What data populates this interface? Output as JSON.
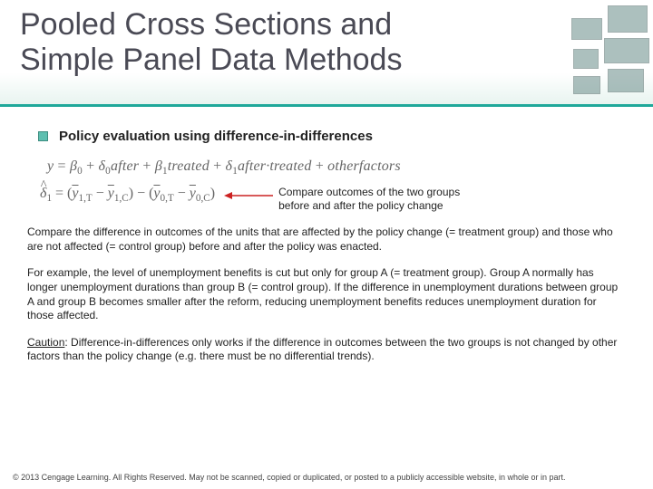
{
  "header": {
    "title_line1": "Pooled Cross Sections and",
    "title_line2": "Simple Panel Data Methods"
  },
  "bullet": {
    "heading": "Policy evaluation using difference-in-differences"
  },
  "equations": {
    "main": "y = β₀ + δ₀after + β₁treated + δ₁after·treated + otherfactors",
    "delta_lhs": "δ",
    "delta_sub": "1",
    "delta_eq": " = (",
    "y1t": "y",
    "y1t_sub": "1,T",
    "minus": " − ",
    "y1c": "y",
    "y1c_sub": "1,C",
    "mid": ") − (",
    "y0t": "y",
    "y0t_sub": "0,T",
    "y0c": "y",
    "y0c_sub": "0,C",
    "end": ")"
  },
  "annotation": {
    "text": "Compare outcomes of the two groups before and after the policy change"
  },
  "paragraphs": {
    "p1": "Compare the difference in outcomes of the units that are affected by the policy change (= treatment group) and those who are not affected (= control group) before and after the policy was enacted.",
    "p2": "For example, the level of unemployment benefits is cut but only for group A (= treatment group). Group A normally has longer unemployment durations than group B (= control group). If the difference in unemployment durations between group A and group B becomes smaller after the reform, reducing unemployment benefits reduces unemployment duration for those affected.",
    "caution_label": "Caution",
    "p3": ": Difference-in-differences only works if the difference in outcomes between the two groups is not changed by other factors than the policy change (e.g. there must be no differential trends)."
  },
  "footer": {
    "text": "© 2013 Cengage Learning. All Rights Reserved. May not be scanned, copied or duplicated, or posted to a publicly accessible website, in whole or in part."
  }
}
